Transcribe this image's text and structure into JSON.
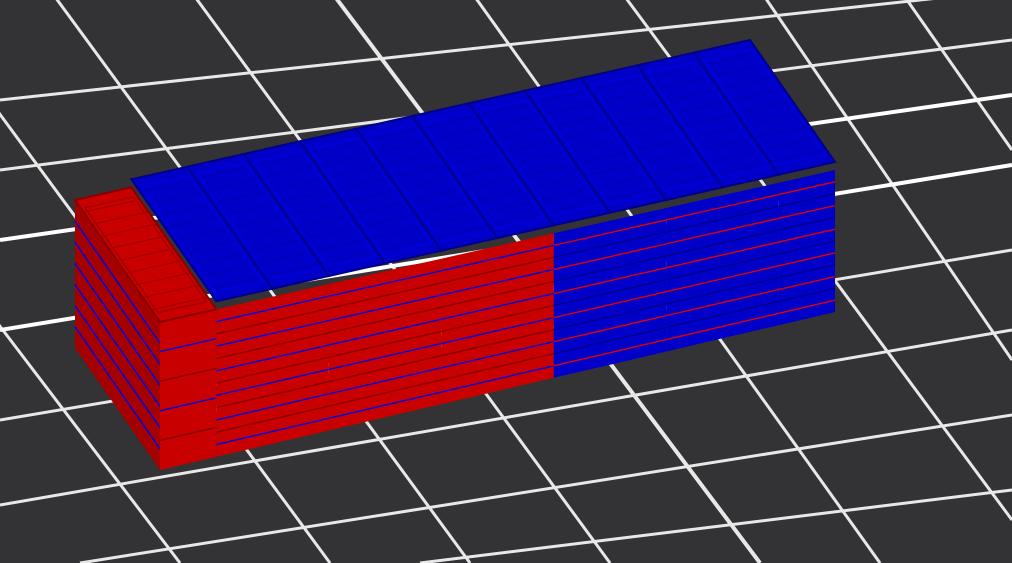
{
  "view": {
    "background_color": "#333335",
    "grid_line_color": "#e8e8e8",
    "grid_bright_color": "#ffffff"
  },
  "model": {
    "palette": {
      "red": "#c80000",
      "red_dark": "#8a0000",
      "red_mid": "#a50000",
      "blue": "#0000c8",
      "blue_dark": "#00008a",
      "blue_mid": "#0000a5",
      "stripe_blue": "#0000e0",
      "stripe_red": "#e00000"
    },
    "segments": [
      {
        "top": "red",
        "side": "red",
        "stripe": "blue"
      },
      {
        "top": "blue",
        "side": "red",
        "stripe": "blue"
      },
      {
        "top": "blue",
        "side": "red",
        "stripe": "blue"
      },
      {
        "top": "blue",
        "side": "red",
        "stripe": "blue"
      },
      {
        "top": "blue",
        "side": "red",
        "stripe": "blue"
      },
      {
        "top": "blue",
        "side": "red",
        "stripe": "blue"
      },
      {
        "top": "blue",
        "side": "red",
        "stripe": "blue"
      },
      {
        "top": "blue",
        "side": "blue",
        "stripe": "red"
      },
      {
        "top": "blue",
        "side": "blue",
        "stripe": "red"
      },
      {
        "top": "blue",
        "side": "blue",
        "stripe": "red"
      },
      {
        "top": "blue",
        "side": "blue",
        "stripe": "red"
      },
      {
        "top": "blue",
        "side": "blue",
        "stripe": "red"
      }
    ]
  }
}
